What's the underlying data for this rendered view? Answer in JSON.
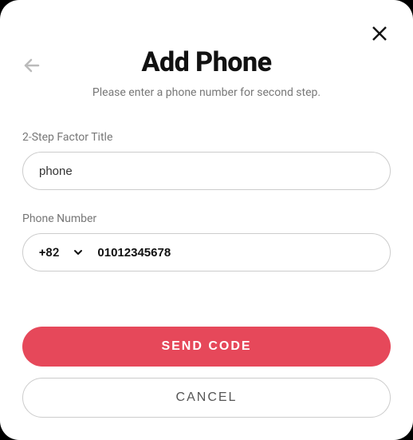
{
  "header": {
    "title": "Add Phone",
    "subtitle": "Please enter a phone number for second step."
  },
  "form": {
    "title_label": "2-Step Factor Title",
    "title_value": "phone",
    "phone_label": "Phone Number",
    "country_code": "+82",
    "phone_value": "01012345678"
  },
  "actions": {
    "primary": "SEND CODE",
    "secondary": "CANCEL"
  }
}
